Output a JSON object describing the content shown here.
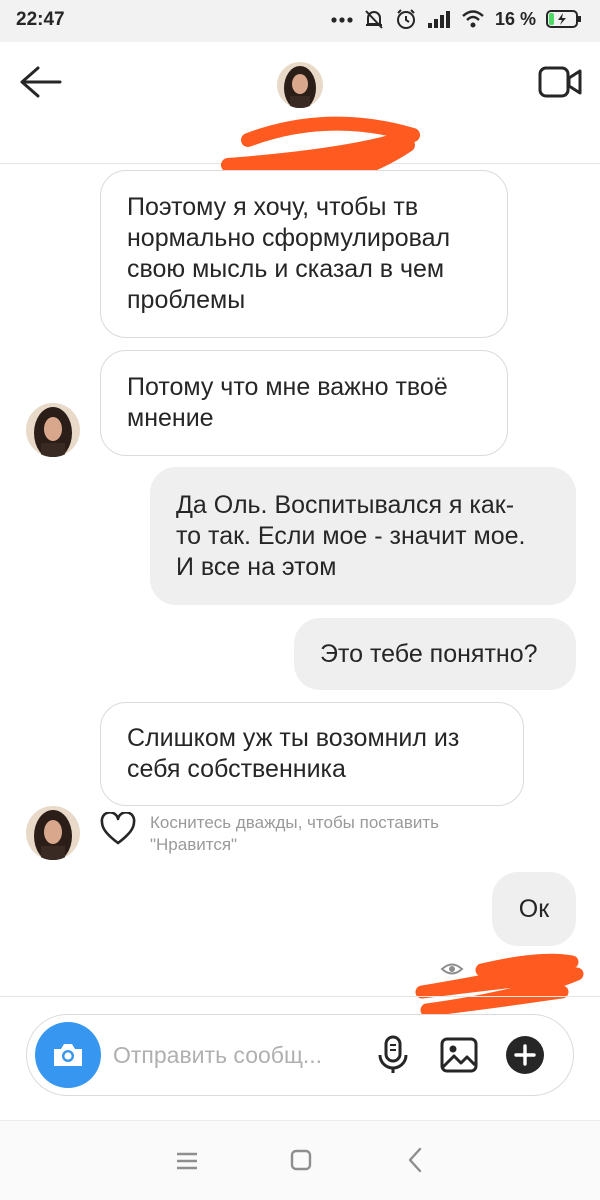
{
  "status_bar": {
    "time": "22:47",
    "battery_percent": "16 %",
    "icons": [
      "dots-icon",
      "mute-bell-icon",
      "alarm-icon",
      "signal-icon",
      "wifi-icon",
      "battery-charging-icon"
    ]
  },
  "header": {
    "back_icon": "arrow-left-icon",
    "video_icon": "video-camera-icon",
    "contact_name_redacted": true
  },
  "messages": [
    {
      "direction": "incoming",
      "text": "Поэтому я хочу, чтобы тв\nнормально сформулировал\nсвою мысль и сказал в чем\nпроблемы"
    },
    {
      "direction": "incoming",
      "text": "Потому что мне важно твоё\nмнение"
    },
    {
      "direction": "outgoing",
      "text": "Да Оль. Воспитывался я как-\nто так. Если мое - значит мое.\nИ все на этом"
    },
    {
      "direction": "outgoing",
      "text": "Это тебе понятно?"
    },
    {
      "direction": "incoming",
      "text": "Слишком уж ты возомнил из\nсебя собственника"
    },
    {
      "direction": "outgoing",
      "text": "Ок"
    }
  ],
  "like_hint": "Коснитесь дважды, чтобы поставить\n\"Нравится\"",
  "composer": {
    "placeholder": "Отправить сообщ...",
    "value": "",
    "accent_color": "#3797f0"
  },
  "colors": {
    "incoming_bubble_border": "#dbdbdb",
    "outgoing_bubble_bg": "#efefef",
    "redaction": "#ff5a1f"
  }
}
